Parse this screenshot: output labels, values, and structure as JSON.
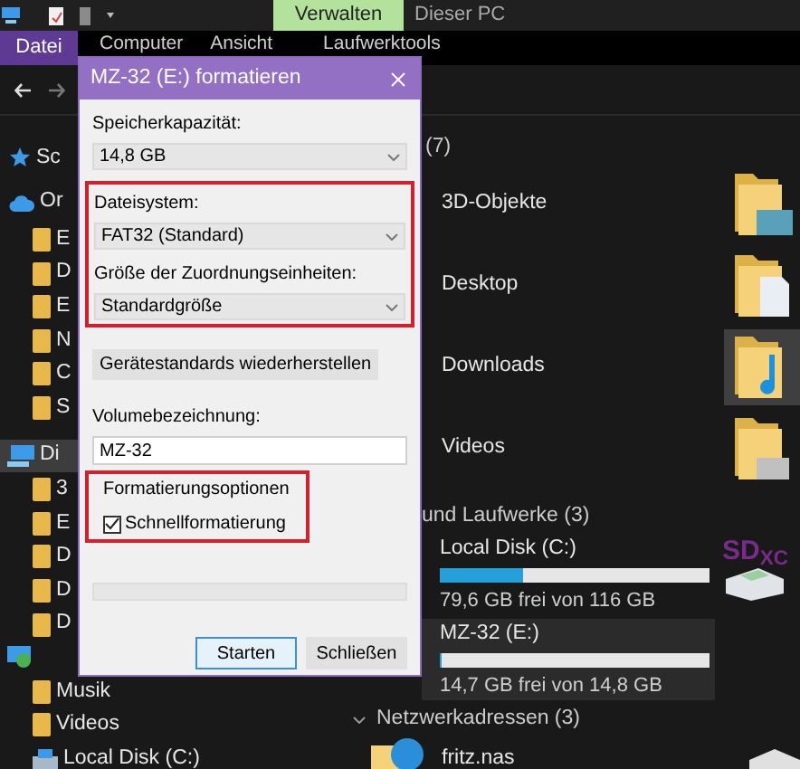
{
  "title_bar": {
    "context_tab": "Verwalten",
    "title": "Dieser PC"
  },
  "ribbon_tabs": [
    {
      "label": "Datei",
      "kind": "file",
      "selected": false
    },
    {
      "label": "Computer",
      "kind": "tab",
      "selected": false
    },
    {
      "label": "Ansicht",
      "kind": "tab",
      "selected": false
    },
    {
      "label": "Laufwerktools",
      "kind": "tab",
      "selected": false
    }
  ],
  "nav_pane": {
    "items": [
      {
        "label": "Sc",
        "kind": "star",
        "selected": false
      },
      {
        "label": "Or",
        "kind": "cloud",
        "selected": false
      },
      {
        "label": "E",
        "kind": "folder",
        "selected": false
      },
      {
        "label": "D",
        "kind": "folder",
        "selected": false
      },
      {
        "label": "E",
        "kind": "folder",
        "selected": false
      },
      {
        "label": "N",
        "kind": "folder",
        "selected": false
      },
      {
        "label": "C",
        "kind": "folder",
        "selected": false
      },
      {
        "label": "S",
        "kind": "folder",
        "selected": false
      },
      {
        "label": "Di",
        "kind": "pc",
        "selected": true
      },
      {
        "label": "3",
        "kind": "folder",
        "selected": false
      },
      {
        "label": "E",
        "kind": "folder",
        "selected": false
      },
      {
        "label": "D",
        "kind": "folder",
        "selected": false
      },
      {
        "label": "D",
        "kind": "folder",
        "selected": false
      },
      {
        "label": "D",
        "kind": "folder",
        "selected": false
      },
      {
        "kind": "network",
        "selected": false
      },
      {
        "label": "Musik",
        "kind": "folder",
        "selected": false
      },
      {
        "label": "Videos",
        "kind": "folder",
        "selected": false
      },
      {
        "label": "Local Disk (C:)",
        "kind": "disk",
        "selected": false
      }
    ]
  },
  "content": {
    "folders_header": "(7)",
    "folders": [
      {
        "label": "3D-Objekte",
        "selected": false
      },
      {
        "label": "Desktop",
        "selected": false
      },
      {
        "label": "Downloads",
        "selected": true
      },
      {
        "label": "Videos",
        "selected": false
      }
    ],
    "drives_header": "und Laufwerke (3)",
    "drives": [
      {
        "name": "Local Disk (C:)",
        "level": 0.31,
        "free": "79,6 GB frei von 116 GB",
        "selected": false
      },
      {
        "name": "MZ-32 (E:)",
        "level": 0.01,
        "free": "14,7 GB frei von 14,8 GB",
        "selected": true
      }
    ],
    "sd_logo": "SD$_{XC}$",
    "network_header": "Netzwerkadressen (3)",
    "network": [
      {
        "label": "fritz.nas"
      }
    ]
  },
  "dialog": {
    "title": "MZ-32 (E:) formatieren",
    "capacity_label": "Speicherkapazität:",
    "capacity_value": "14,8 GB",
    "file_system_label": "Dateisystem:",
    "file_system_value": "FAT32 (Standard)",
    "allocation_label": "Größe der Zuordnungseinheiten:",
    "allocation_value": "Standardgröße",
    "restore_button": "Gerätestandards wiederherstellen",
    "volume_label": "Volumebezeichnung:",
    "volume_value": "MZ-32",
    "options_title": "Formatierungsoptionen",
    "quick_format": {
      "label": "Schnellformatierung",
      "checked": true
    },
    "progress": {
      "level": 0
    },
    "buttons": [
      {
        "label": "Starten",
        "default": true
      },
      {
        "label": "Schließen",
        "default": false
      }
    ]
  }
}
